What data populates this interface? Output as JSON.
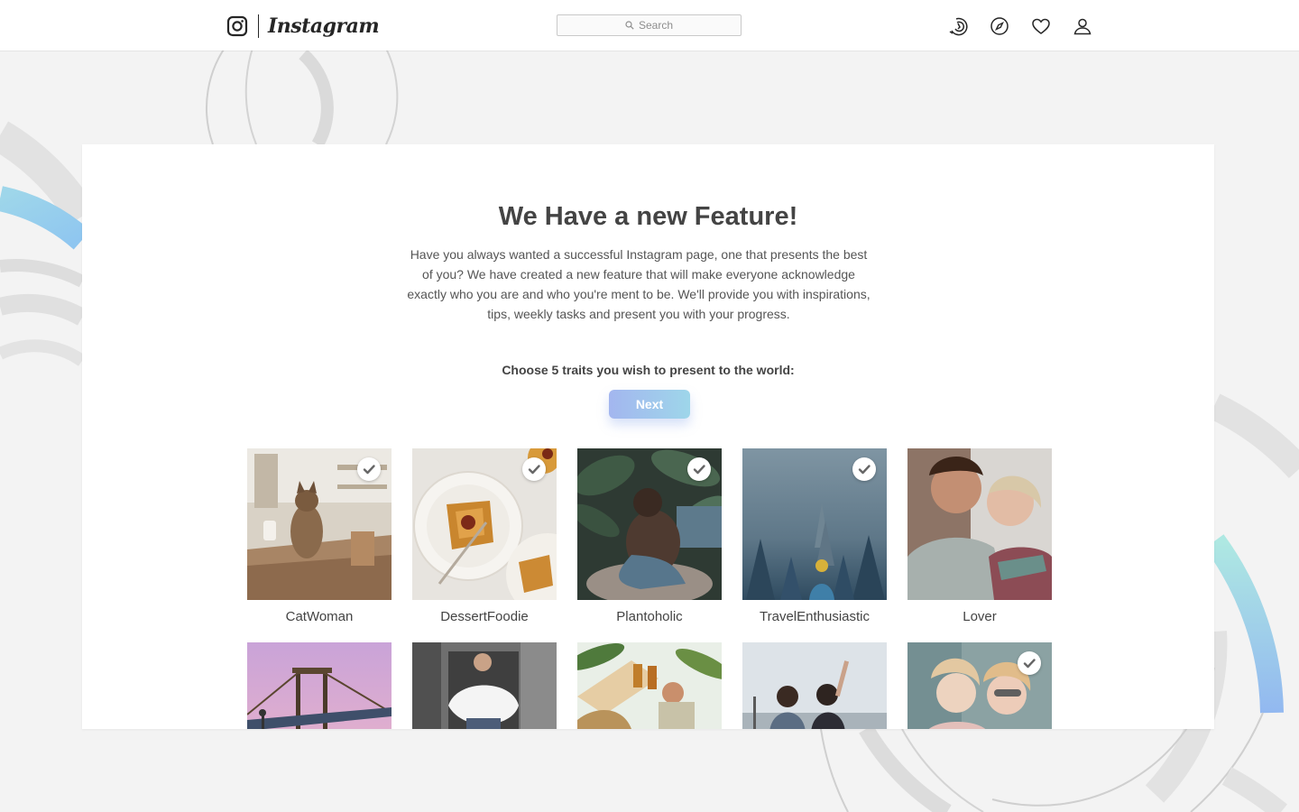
{
  "header": {
    "wordmark": "Instagram",
    "search_placeholder": "Search",
    "icons": [
      "instagram-glyph-icon",
      "search-icon",
      "activity-icon",
      "compass-icon",
      "heart-icon",
      "profile-icon"
    ]
  },
  "feature": {
    "title": "We Have a new Feature!",
    "description": "Have you always wanted a successful Instagram page, one that presents the best of you? We have created a new feature that will make everyone acknowledge exactly who you are and who you're ment to be. We'll provide you with inspirations, tips, weekly tasks and present you with your progress.",
    "prompt": "Choose 5 traits you wish to present to the world:",
    "next_label": "Next"
  },
  "traits": [
    {
      "label": "CatWoman",
      "selected": true,
      "image": "cat on wooden table photo"
    },
    {
      "label": "DessertFoodie",
      "selected": true,
      "image": "dessert plates photo"
    },
    {
      "label": "Plantoholic",
      "selected": true,
      "image": "woman among plants photo"
    },
    {
      "label": "TravelEnthusiastic",
      "selected": true,
      "image": "foggy forest photo"
    },
    {
      "label": "Lover",
      "selected": false,
      "image": "couple kissing photo"
    },
    {
      "label": "",
      "selected": false,
      "image": "bridge at sunset photo"
    },
    {
      "label": "",
      "selected": false,
      "image": "woman in white fur jacket photo"
    },
    {
      "label": "",
      "selected": false,
      "image": "friends toasting drinks photo"
    },
    {
      "label": "",
      "selected": false,
      "image": "two friends at overlook photo"
    },
    {
      "label": "",
      "selected": true,
      "image": "two women with sunglasses photo"
    }
  ],
  "colors": {
    "accent_gradient_start": "#a3b6ef",
    "accent_gradient_end": "#9ed6ea",
    "page_background": "#f3f3f3",
    "card_background": "#ffffff"
  }
}
